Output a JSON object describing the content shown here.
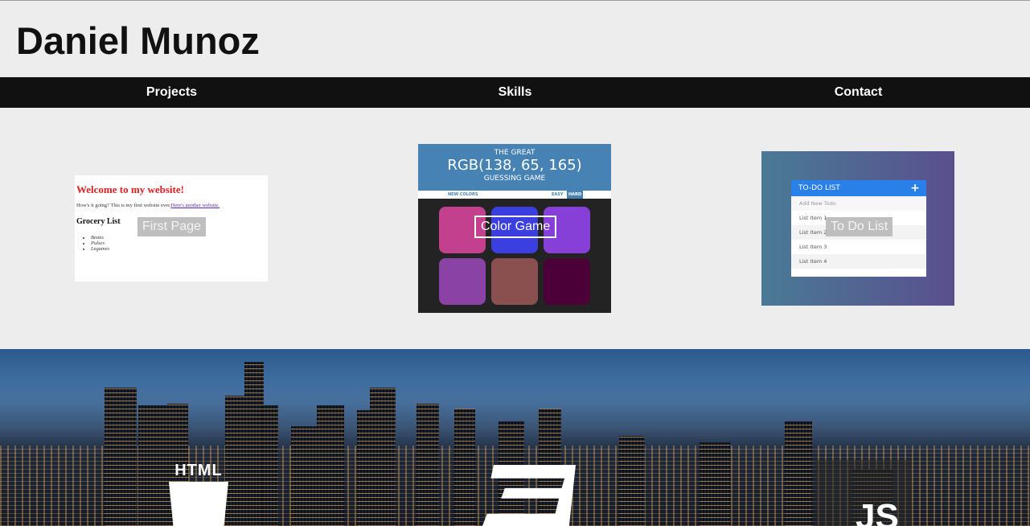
{
  "header": {
    "title": "Daniel Munoz"
  },
  "nav": {
    "items": [
      "Projects",
      "Skills",
      "Contact"
    ]
  },
  "projects": {
    "first_page": {
      "label": "First Page",
      "heading": "Welcome to my website!",
      "text": "How's it going? This is my first website ever.",
      "link": "Here's another website.",
      "list_title": "Grocery List",
      "list": [
        "Beans",
        "Pulses",
        "Legumes"
      ]
    },
    "color_game": {
      "label": "Color Game",
      "line1": "THE GREAT",
      "line2": "RGB(138, 65, 165)",
      "line3": "GUESSING GAME",
      "new_colors": "NEW COLORS",
      "easy": "EASY",
      "hard": "HARD",
      "squares": [
        "#c2408e",
        "#3b3fe0",
        "#8640d8",
        "#8a42a5",
        "#8a5050",
        "#4c0038"
      ]
    },
    "todo": {
      "label": "To Do List",
      "title": "TO-DO LIST",
      "input_placeholder": "Add New Todo",
      "items": [
        "List Item 1",
        "List Item 2",
        "List Item 3",
        "List Item 4"
      ]
    }
  },
  "skills": {
    "html_logo": "HTML",
    "js_logo": "JS"
  }
}
